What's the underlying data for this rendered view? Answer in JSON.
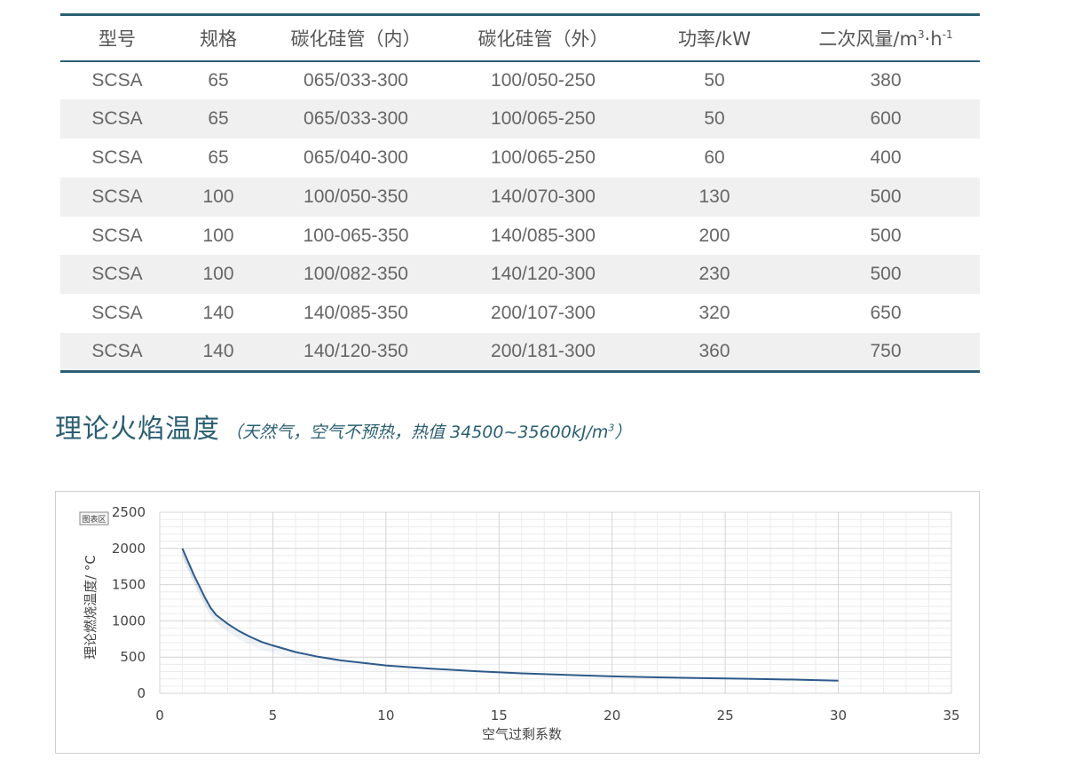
{
  "table": {
    "headers": {
      "model": "型号",
      "spec": "规格",
      "inner_tube": "碳化硅管（内）",
      "outer_tube": "碳化硅管（外）",
      "power": "功率/kW",
      "airflow_main": "二次风量/m",
      "airflow_sup": "3",
      "airflow_mid": "·h",
      "airflow_sup2": "-1"
    },
    "rows": [
      [
        "SCSA",
        "65",
        "065/033-300",
        "100/050-250",
        "50",
        "380"
      ],
      [
        "SCSA",
        "65",
        "065/033-300",
        "100/065-250",
        "50",
        "600"
      ],
      [
        "SCSA",
        "65",
        "065/040-300",
        "100/065-250",
        "60",
        "400"
      ],
      [
        "SCSA",
        "100",
        "100/050-350",
        "140/070-300",
        "130",
        "500"
      ],
      [
        "SCSA",
        "100",
        "100-065-350",
        "140/085-300",
        "200",
        "500"
      ],
      [
        "SCSA",
        "100",
        "100/082-350",
        "140/120-300",
        "230",
        "500"
      ],
      [
        "SCSA",
        "140",
        "140/085-350",
        "200/107-300",
        "320",
        "650"
      ],
      [
        "SCSA",
        "140",
        "140/120-350",
        "200/181-300",
        "360",
        "750"
      ]
    ]
  },
  "section": {
    "title": "理论火焰温度",
    "subtitle": "（天然气，空气不预热，热值 34500~35600kJ/m",
    "subtitle_sup": "3",
    "subtitle_end": "）"
  },
  "chart_data": {
    "type": "line",
    "chart_area_tag": "图表区",
    "xlabel": "空气过剩系数",
    "ylabel": "理论燃烧温度/ °C",
    "xlim": [
      0,
      35
    ],
    "ylim": [
      0,
      2500
    ],
    "xticks": [
      "0",
      "5",
      "10",
      "15",
      "20",
      "25",
      "30",
      "35"
    ],
    "yticks": [
      "0",
      "500",
      "1000",
      "1500",
      "2000",
      "2500"
    ],
    "grid": true,
    "line_color": "#2e5a8a",
    "series": [
      {
        "x": [
          1.0,
          1.25,
          1.5,
          1.75,
          2.0,
          2.25,
          2.5,
          3.0,
          3.5,
          4.0,
          4.5,
          5.0,
          6.0,
          7.0,
          8.0,
          9.0,
          10.0,
          12.0,
          14.0,
          16.0,
          18.0,
          20.0,
          22.0,
          24.0,
          26.0,
          28.0,
          30.0
        ],
        "y": [
          2000,
          1820,
          1640,
          1480,
          1320,
          1180,
          1080,
          960,
          860,
          780,
          710,
          660,
          570,
          505,
          455,
          420,
          385,
          340,
          305,
          275,
          255,
          235,
          220,
          210,
          200,
          190,
          175
        ]
      }
    ]
  }
}
